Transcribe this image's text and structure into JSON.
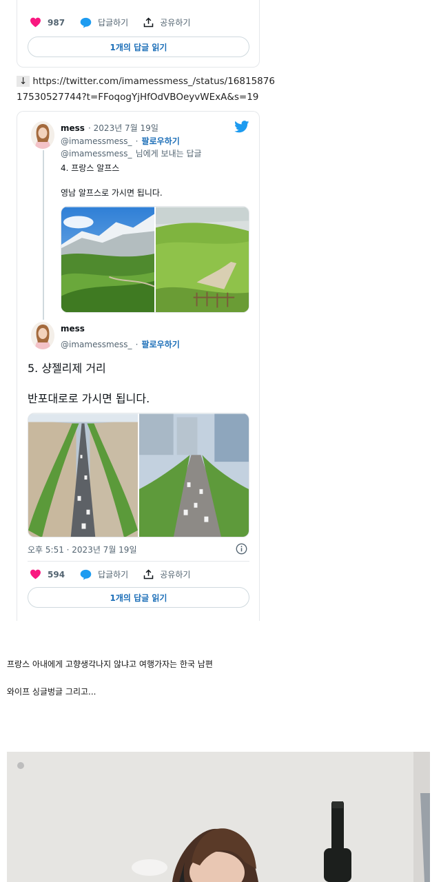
{
  "tweet1": {
    "likes": "987",
    "reply_label": "답글하기",
    "share_label": "공유하기",
    "read_replies": "1개의 답글 읽기"
  },
  "link": {
    "arrow": "↓",
    "line1": "https://twitter.com/imamessmess_/status/16815876",
    "line2": "17530527744?t=FFoqogYjHfOdVBOeyvWExA&s=19"
  },
  "tweet2": {
    "name": "mess",
    "date": "· 2023년 7월 19일",
    "handle": "@imamessmess_",
    "follow": "팔로우하기",
    "replying_handle": "@imamessmess_",
    "replying_suffix": "님에게 보내는 답글",
    "line1": "4. 프랑스 알프스",
    "line2": "영남 알프스로 가시면 됩니다."
  },
  "tweet3": {
    "name": "mess",
    "handle": "@imamessmess_",
    "follow": "팔로우하기",
    "line1": "5. 샹젤리제 거리",
    "line2": "반포대로로 가시면 됩니다.",
    "timestamp": "오후 5:51 · 2023년 7월 19일",
    "likes": "594",
    "reply_label": "답글하기",
    "share_label": "공유하기",
    "read_replies": "1개의 답글 읽기"
  },
  "post": {
    "line1": "프랑스 아내에게 고향생각나지 않냐고 여행가자는 한국 남편",
    "line2": "와이프 싱글벙글 그리고..."
  },
  "colors": {
    "heart": "#f91880",
    "reply_bubble": "#1d9bf0",
    "twitter_blue": "#1d9bf0",
    "link_blue": "#1d6fb8"
  },
  "icons": [
    "heart-icon",
    "reply-bubble-icon",
    "share-icon",
    "twitter-bird-icon",
    "info-icon",
    "more-icon"
  ]
}
